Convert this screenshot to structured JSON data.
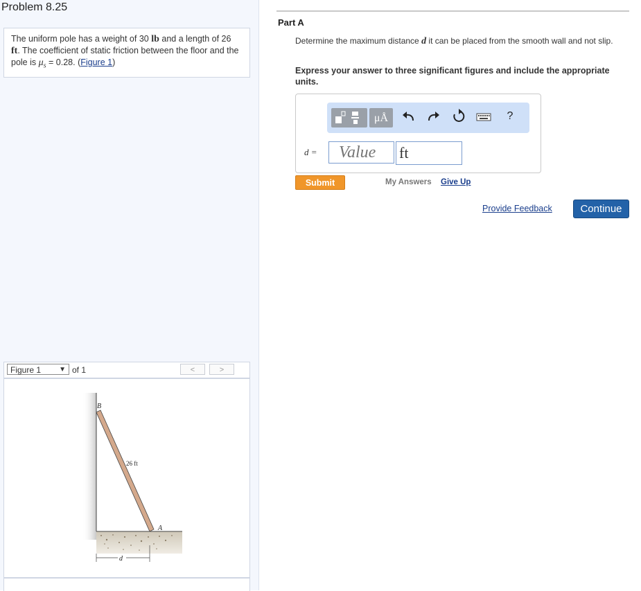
{
  "problem": {
    "title": "Problem 8.25",
    "text_before_weight": "The uniform pole has a weight of 30 ",
    "weight_unit": "lb",
    "text_before_length": " and a length of 26 ",
    "length_unit": "ft",
    "text_after_length": ". The coefficient of static friction between the floor and the pole is ",
    "mu_symbol": "μ",
    "mu_subscript": "s",
    "mu_value": " = 0.28. (",
    "figure_link": "Figure 1",
    "close_paren": ")"
  },
  "figure": {
    "select_label": "Figure 1",
    "of_label": "of 1",
    "prev": "<",
    "next": ">",
    "label_B": "B",
    "label_A": "A",
    "label_length": "26 ft",
    "label_d": "d"
  },
  "part": {
    "title": "Part A",
    "question_before_var": "Determine the maximum distance ",
    "question_var": "d",
    "question_after_var": " it can be placed from the smooth wall and not slip.",
    "instruction": "Express your answer to three significant figures and include the appropriate units."
  },
  "answer": {
    "d_label": "d =",
    "value_placeholder": "Value",
    "unit_value": "ft",
    "units_icon": "μÅ",
    "help_icon": "?"
  },
  "actions": {
    "submit": "Submit",
    "my_answers": "My Answers",
    "give_up": "Give Up",
    "feedback": "Provide Feedback",
    "continue": "Continue"
  },
  "colors": {
    "submit": "#f0962a",
    "continue": "#2362a8",
    "toolbar": "#cfe0f8",
    "link": "#1a3e8c"
  }
}
